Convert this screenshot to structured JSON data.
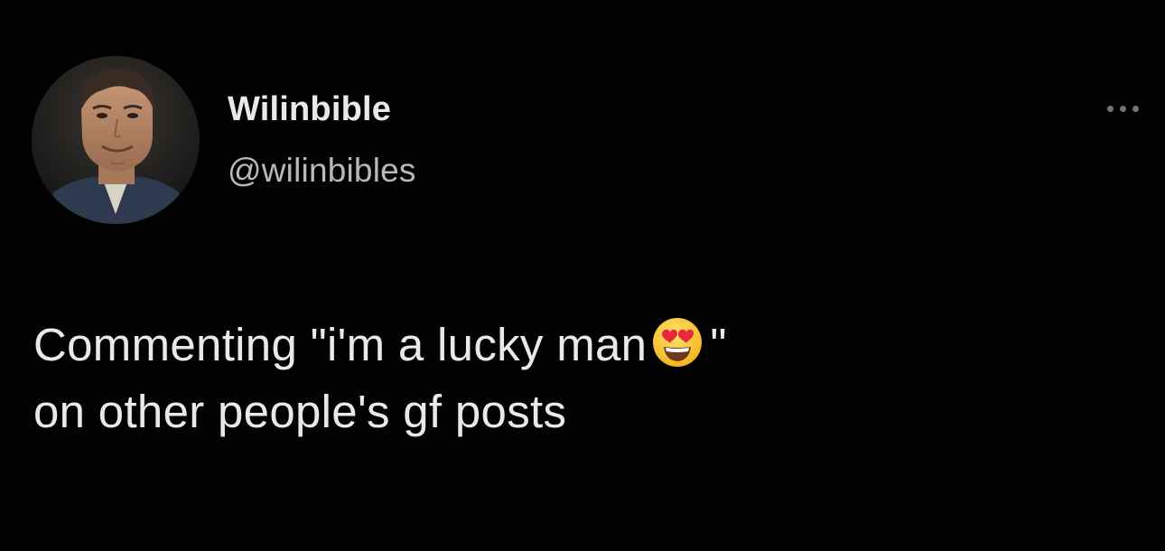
{
  "user": {
    "display_name": "Wilinbible",
    "handle": "@wilinbibles"
  },
  "tweet": {
    "line1_before_emoji": "Commenting \"i'm a lucky man",
    "line1_after_emoji": "\"",
    "line2": "on other people's gf posts",
    "emoji": "smiling-face-with-heart-eyes"
  },
  "icons": {
    "more": "more-options-icon",
    "avatar": "profile-avatar"
  },
  "colors": {
    "background": "#020202",
    "text": "#e7e9ea",
    "secondary_text": "#b6babf",
    "icon_gray": "#6e767d"
  }
}
